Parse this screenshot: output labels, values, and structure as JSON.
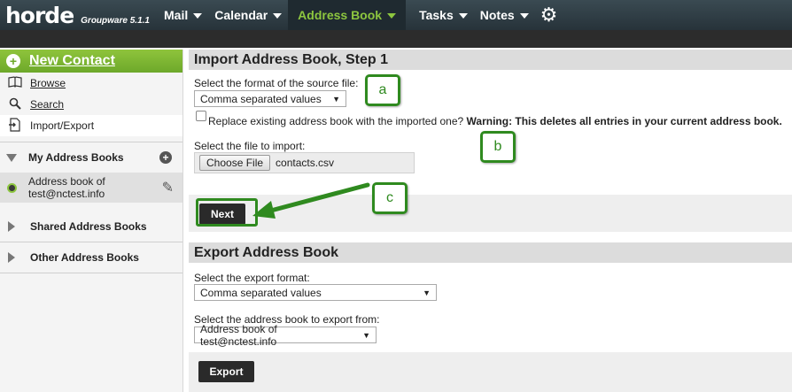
{
  "app": {
    "logo": "horde",
    "version": "Groupware 5.1.1"
  },
  "nav": {
    "items": [
      {
        "label": "Mail"
      },
      {
        "label": "Calendar"
      },
      {
        "label": "Address Book"
      },
      {
        "label": "Tasks"
      },
      {
        "label": "Notes"
      }
    ],
    "active": "Address Book",
    "settings_icon": "gear-icon"
  },
  "sidebar": {
    "new_contact": "New Contact",
    "links": [
      {
        "label": "Browse",
        "icon": "book-icon"
      },
      {
        "label": "Search",
        "icon": "search-icon"
      },
      {
        "label": "Import/Export",
        "icon": "import-export-icon"
      }
    ],
    "my_address_books": "My Address Books",
    "book_item": "Address book of test@nctest.info",
    "shared_address_books": "Shared Address Books",
    "other_address_books": "Other Address Books"
  },
  "import": {
    "title": "Import Address Book, Step 1",
    "format_label": "Select the format of the source file:",
    "format_value": "Comma separated values",
    "replace_label": "Replace existing address book with the imported one?",
    "replace_checked": false,
    "warning": "Warning: This deletes all entries in your current address book.",
    "file_label": "Select the file to import:",
    "choose_file": "Choose File",
    "file_name": "contacts.csv",
    "next_button": "Next"
  },
  "export": {
    "title": "Export Address Book",
    "format_label": "Select the export format:",
    "format_value": "Comma separated values",
    "source_label": "Select the address book to export from:",
    "source_value": "Address book of test@nctest.info",
    "export_button": "Export"
  },
  "annotations": {
    "a": "a",
    "b": "b",
    "c": "c",
    "color": "#2f8a1f"
  }
}
